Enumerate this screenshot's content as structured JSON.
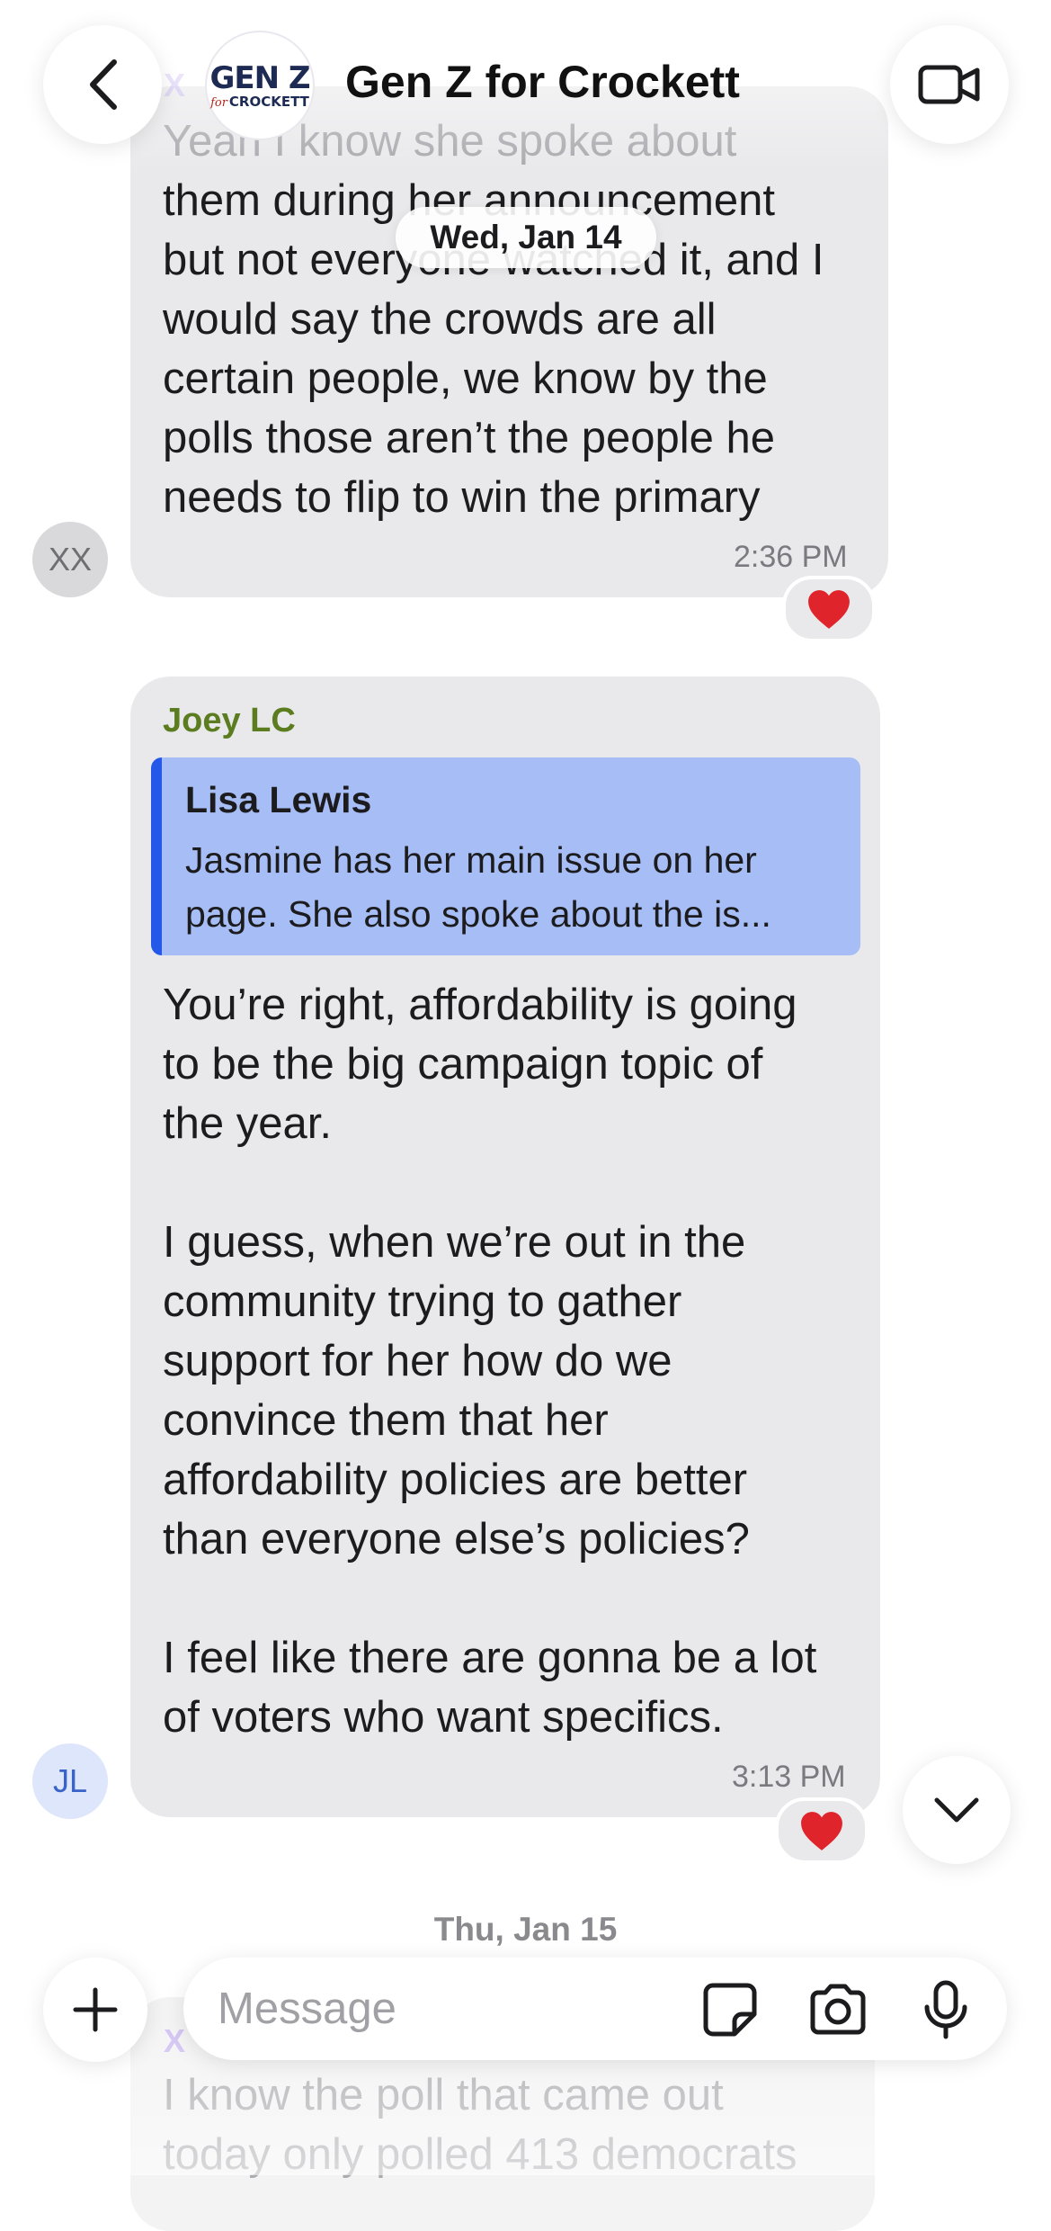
{
  "header": {
    "title": "Gen Z for Crockett",
    "group_avatar_line1": "GEN Z",
    "group_avatar_line2_prefix": "for",
    "group_avatar_line2": "CROCKETT",
    "back_icon": "chevron-left-icon",
    "video_icon": "video-camera-icon"
  },
  "date_pill": "Wed, Jan 14",
  "messages": [
    {
      "sender_initials_partial": "X",
      "text_faded": "Yeah I know she spoke about",
      "text": "them during her announcement\nbut not everyone watched it, and I\nwould say the crowds are all\ncertain people, we know by the\npolls those aren’t the people he\nneeds to flip to win the primary",
      "time": "2:36 PM",
      "avatar_initials": "XX",
      "reaction": "❤️"
    },
    {
      "sender": "Joey LC",
      "reply_to": {
        "name": "Lisa Lewis",
        "snippet": "Jasmine has her main issue on her page. She also spoke about the is..."
      },
      "text": "You’re right, affordability is going\nto be the big campaign topic of\nthe year.\n\nI guess, when we’re out in the\ncommunity trying to gather\nsupport for her how do we\nconvince them that her\naffordability policies are better\nthan everyone else’s policies?\n\nI feel like there are gonna be a lot\nof voters who want specifics.",
      "time": "3:13 PM",
      "avatar_initials": "JL",
      "reaction": "❤️"
    },
    {
      "sender_partial": "X",
      "text": "I know the poll that came out\ntoday only polled 413 democrats"
    }
  ],
  "date_label_2": "Thu, Jan 15",
  "composer": {
    "placeholder": "Message",
    "add_icon": "plus-icon",
    "sticker_icon": "sticker-icon",
    "camera_icon": "camera-icon",
    "mic_icon": "microphone-icon"
  },
  "scroll_down_icon": "chevron-down-icon",
  "colors": {
    "bubble": "#e9e9eb",
    "sender_joey": "#5b7c1f",
    "quote_bg": "#a6bdf5",
    "quote_bar": "#2458e8",
    "reaction_heart": "#e0242b"
  }
}
